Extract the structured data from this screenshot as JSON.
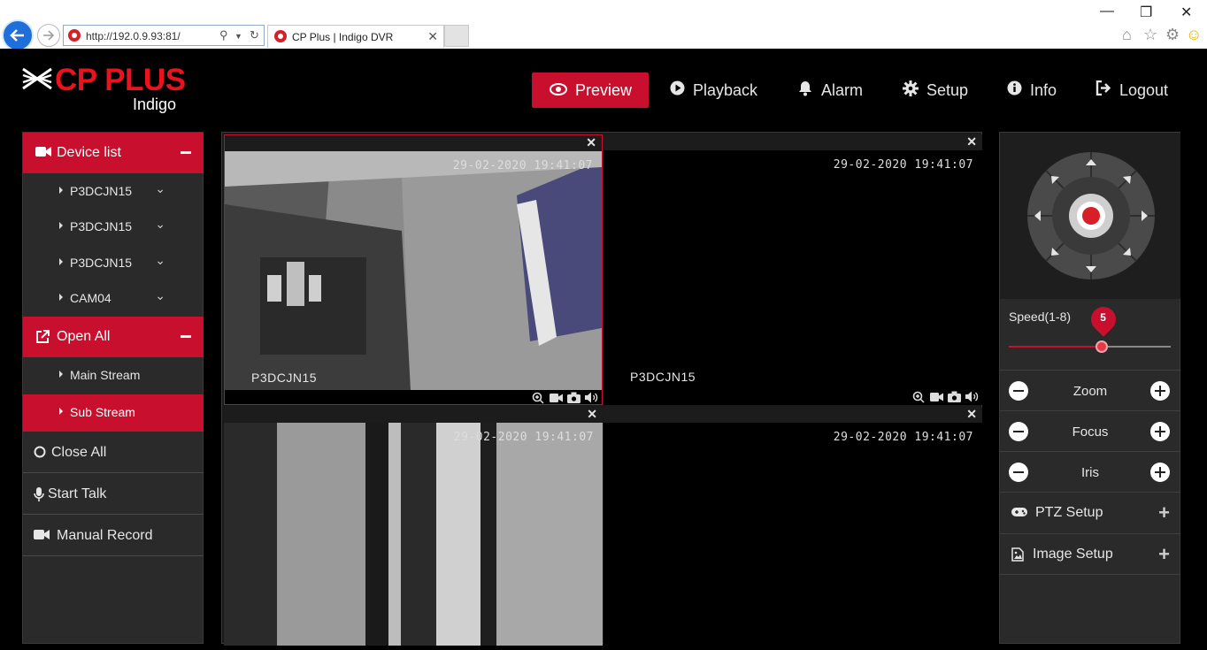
{
  "browser": {
    "url": "http://192.0.9.93:81/",
    "tab_title": "CP Plus | Indigo DVR"
  },
  "brand": {
    "name": "CP PLUS",
    "sub": "Indigo",
    "accent_color": "#c8102e"
  },
  "topnav": [
    {
      "label": "Preview",
      "icon": "eye-icon",
      "active": true
    },
    {
      "label": "Playback",
      "icon": "play-circle-icon"
    },
    {
      "label": "Alarm",
      "icon": "bell-icon"
    },
    {
      "label": "Setup",
      "icon": "gear-icon"
    },
    {
      "label": "Info",
      "icon": "info-icon"
    },
    {
      "label": "Logout",
      "icon": "logout-icon"
    }
  ],
  "sidebar": {
    "device_list": {
      "label": "Device list",
      "devices": [
        "P3DCJN15",
        "P3DCJN15",
        "P3DCJN15",
        "CAM04"
      ]
    },
    "open_all": {
      "label": "Open All",
      "streams": [
        "Main Stream",
        "Sub Stream"
      ],
      "selected_stream": "Sub Stream"
    },
    "actions": [
      "Close All",
      "Start Talk",
      "Manual Record"
    ]
  },
  "cameras": [
    {
      "name": "P3DCJN15",
      "timestamp": "29-02-2020 19:41:07",
      "active": true
    },
    {
      "name": "P3DCJN15",
      "timestamp": "29-02-2020 19:41:07",
      "active": false
    },
    {
      "name": "",
      "timestamp": "29-02-2020 19:41:07",
      "active": false
    },
    {
      "name": "",
      "timestamp": "29-02-2020 19:41:07",
      "active": false
    }
  ],
  "ptz": {
    "speed_label": "Speed(1-8)",
    "speed_value": "5",
    "speed_min": 1,
    "speed_max": 8,
    "controls": [
      "Zoom",
      "Focus",
      "Iris"
    ],
    "sections": [
      "PTZ Setup",
      "Image Setup"
    ]
  }
}
